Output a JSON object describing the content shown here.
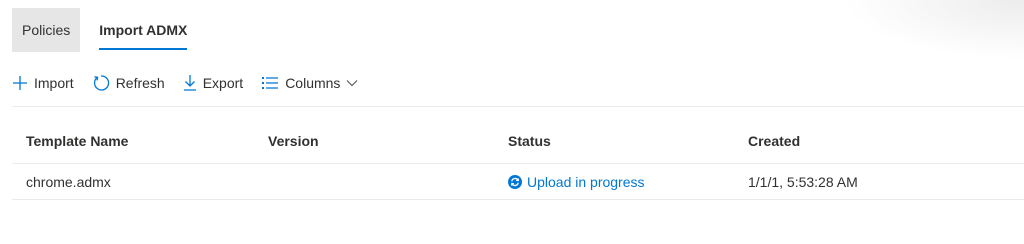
{
  "tabs": [
    {
      "label": "Policies"
    },
    {
      "label": "Import ADMX"
    }
  ],
  "toolbar": {
    "import_label": "Import",
    "refresh_label": "Refresh",
    "export_label": "Export",
    "columns_label": "Columns"
  },
  "table": {
    "headers": [
      "Template Name",
      "Version",
      "Status",
      "Created"
    ],
    "rows": [
      {
        "name": "chrome.admx",
        "version": "",
        "status": "Upload in progress",
        "created": "1/1/1, 5:53:28 AM"
      }
    ]
  },
  "colors": {
    "accent": "#0078d4",
    "inactive_tab_bg": "#e6e6e6"
  },
  "icons": {
    "import": "plus-icon",
    "refresh": "refresh-icon",
    "export": "download-icon",
    "columns": "list-icon",
    "columns_dropdown": "chevron-down-icon",
    "status": "sync-icon"
  }
}
